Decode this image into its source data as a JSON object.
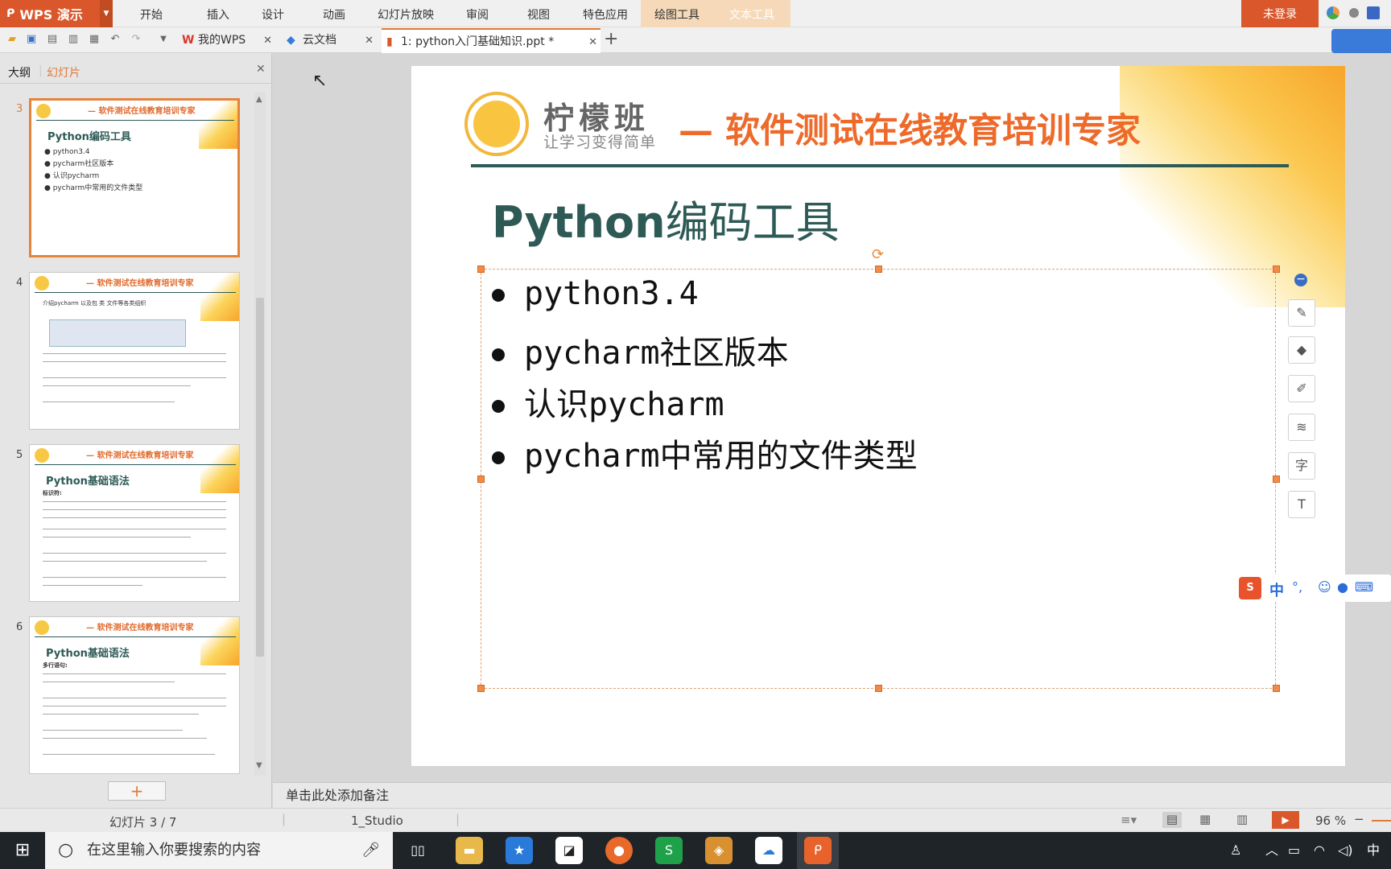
{
  "app": {
    "name": "WPS 演示",
    "logo_glyph": "ᑭ",
    "login_label": "未登录"
  },
  "menu": [
    "开始",
    "插入",
    "设计",
    "动画",
    "幻灯片放映",
    "审阅",
    "视图",
    "特色应用",
    "绘图工具",
    "文本工具"
  ],
  "tabs": [
    {
      "label": "我的WPS",
      "icon": "wps-icon"
    },
    {
      "label": "云文档",
      "icon": "cloud-icon"
    },
    {
      "label": "1:  python入门基础知识.ppt *",
      "icon": "ppt-file-icon"
    }
  ],
  "left_panel": {
    "tab_outline": "大纲",
    "tab_slides": "幻灯片",
    "add_label": "+"
  },
  "thumbnails": [
    {
      "num": "3",
      "header": "— 软件测试在线教育培训专家",
      "title": "Python编码工具",
      "lines": [
        "● python3.4",
        "● pycharm社区版本",
        "● 认识pycharm",
        "● pycharm中常用的文件类型"
      ]
    },
    {
      "num": "4",
      "header": "— 软件测试在线教育培训专家",
      "title": "",
      "lines": [
        "介绍pycharm 以及包 类 文件等各类组织"
      ]
    },
    {
      "num": "5",
      "header": "— 软件测试在线教育培训专家",
      "title": "Python基础语法",
      "lines": [
        "标识符:"
      ]
    },
    {
      "num": "6",
      "header": "— 软件测试在线教育培训专家",
      "title": "Python基础语法",
      "lines": [
        "多行语句:"
      ]
    }
  ],
  "slide": {
    "brand": "柠檬班",
    "slogan": "让学习变得简单",
    "tagline": "— 软件测试在线教育培训专家",
    "title_bold": "Python",
    "title_rest": "编码工具",
    "bullets": [
      "python3.4",
      "pycharm社区版本",
      "认识pycharm",
      "pycharm中常用的文件类型"
    ]
  },
  "notes_placeholder": "单击此处添加备注",
  "status": {
    "slide_counter": "幻灯片 3 / 7",
    "theme": "1_Studio",
    "zoom": "96 %"
  },
  "taskbar": {
    "search_placeholder": "在这里输入你要搜索的内容",
    "ime_label": "中"
  },
  "ime_bar": {
    "lang": "中",
    "punct": "°,"
  },
  "colors": {
    "accent": "#d9572b",
    "brand_orange": "#ee6a2a",
    "title_teal": "#2e5a56",
    "selection": "#e6833a"
  }
}
